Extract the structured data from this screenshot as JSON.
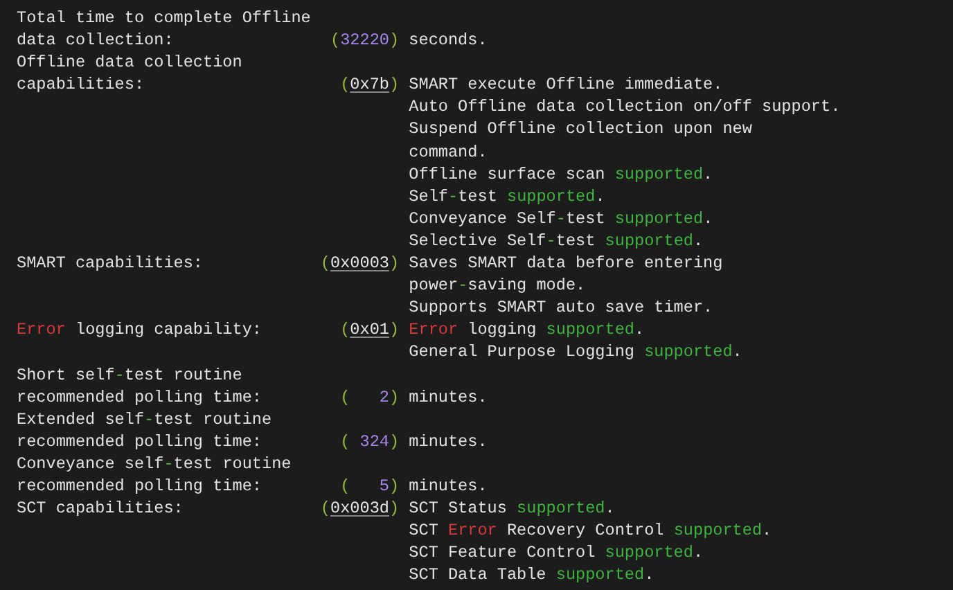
{
  "entries": [
    {
      "label": [
        [
          "Total time to complete Offline"
        ],
        [
          "data collection:"
        ]
      ],
      "value": [
        {
          "text": "(",
          "kind": "paren"
        },
        {
          "text": "32220",
          "kind": "num"
        },
        {
          "text": ")",
          "kind": "paren"
        }
      ],
      "description": [
        [
          "seconds."
        ]
      ]
    },
    {
      "label": [
        [
          "Offline data collection"
        ],
        [
          "capabilities:"
        ]
      ],
      "value": [
        {
          "text": "(",
          "kind": "paren"
        },
        {
          "text": "0x7b",
          "kind": "hex"
        },
        {
          "text": ")",
          "kind": "paren"
        }
      ],
      "description": [
        [
          "SMART execute Offline immediate."
        ],
        [
          "Auto Offline data collection on/off support."
        ],
        [
          "Suspend Offline collection upon new"
        ],
        [
          "command."
        ],
        [
          "Offline surface scan ",
          {
            "text": "supported",
            "kind": "ok"
          },
          "."
        ],
        [
          "Self",
          {
            "text": "-",
            "kind": "sym"
          },
          "test ",
          {
            "text": "supported",
            "kind": "ok"
          },
          "."
        ],
        [
          "Conveyance Self",
          {
            "text": "-",
            "kind": "sym"
          },
          "test ",
          {
            "text": "supported",
            "kind": "ok"
          },
          "."
        ],
        [
          "Selective Self",
          {
            "text": "-",
            "kind": "sym"
          },
          "test ",
          {
            "text": "supported",
            "kind": "ok"
          },
          "."
        ]
      ]
    },
    {
      "label": [
        [
          "SMART capabilities:"
        ]
      ],
      "value": [
        {
          "text": "(",
          "kind": "paren"
        },
        {
          "text": "0x0003",
          "kind": "hex"
        },
        {
          "text": ")",
          "kind": "paren"
        }
      ],
      "description": [
        [
          "Saves SMART data before entering"
        ],
        [
          "power",
          {
            "text": "-",
            "kind": "sym"
          },
          "saving mode."
        ],
        [
          "Supports SMART auto save timer."
        ]
      ]
    },
    {
      "label": [
        [
          {
            "text": "Error",
            "kind": "err"
          },
          " logging capability:"
        ]
      ],
      "value": [
        {
          "text": "(",
          "kind": "paren"
        },
        {
          "text": "0x01",
          "kind": "hex"
        },
        {
          "text": ")",
          "kind": "paren"
        }
      ],
      "description": [
        [
          {
            "text": "Error",
            "kind": "err"
          },
          " logging ",
          {
            "text": "supported",
            "kind": "ok"
          },
          "."
        ],
        [
          "General Purpose Logging ",
          {
            "text": "supported",
            "kind": "ok"
          },
          "."
        ]
      ]
    },
    {
      "label": [
        [
          "Short self",
          {
            "text": "-",
            "kind": "sym"
          },
          "test routine"
        ],
        [
          "recommended polling time:"
        ]
      ],
      "value": [
        {
          "text": "(",
          "kind": "paren"
        },
        {
          "text": "   2",
          "kind": "num"
        },
        {
          "text": ")",
          "kind": "paren"
        }
      ],
      "description": [
        [
          "minutes."
        ]
      ]
    },
    {
      "label": [
        [
          "Extended self",
          {
            "text": "-",
            "kind": "sym"
          },
          "test routine"
        ],
        [
          "recommended polling time:"
        ]
      ],
      "value": [
        {
          "text": "(",
          "kind": "paren"
        },
        {
          "text": " 324",
          "kind": "num"
        },
        {
          "text": ")",
          "kind": "paren"
        }
      ],
      "description": [
        [
          "minutes."
        ]
      ]
    },
    {
      "label": [
        [
          "Conveyance self",
          {
            "text": "-",
            "kind": "sym"
          },
          "test routine"
        ],
        [
          "recommended polling time:"
        ]
      ],
      "value": [
        {
          "text": "(",
          "kind": "paren"
        },
        {
          "text": "   5",
          "kind": "num"
        },
        {
          "text": ")",
          "kind": "paren"
        }
      ],
      "description": [
        [
          "minutes."
        ]
      ]
    },
    {
      "label": [
        [
          "SCT capabilities:"
        ]
      ],
      "value": [
        {
          "text": "(",
          "kind": "paren"
        },
        {
          "text": "0x003d",
          "kind": "hex"
        },
        {
          "text": ")",
          "kind": "paren"
        }
      ],
      "description": [
        [
          "SCT Status ",
          {
            "text": "supported",
            "kind": "ok"
          },
          "."
        ],
        [
          "SCT ",
          {
            "text": "Error",
            "kind": "err"
          },
          " Recovery Control ",
          {
            "text": "supported",
            "kind": "ok"
          },
          "."
        ],
        [
          "SCT Feature Control ",
          {
            "text": "supported",
            "kind": "ok"
          },
          "."
        ],
        [
          "SCT Data Table ",
          {
            "text": "supported",
            "kind": "ok"
          },
          "."
        ]
      ]
    }
  ]
}
